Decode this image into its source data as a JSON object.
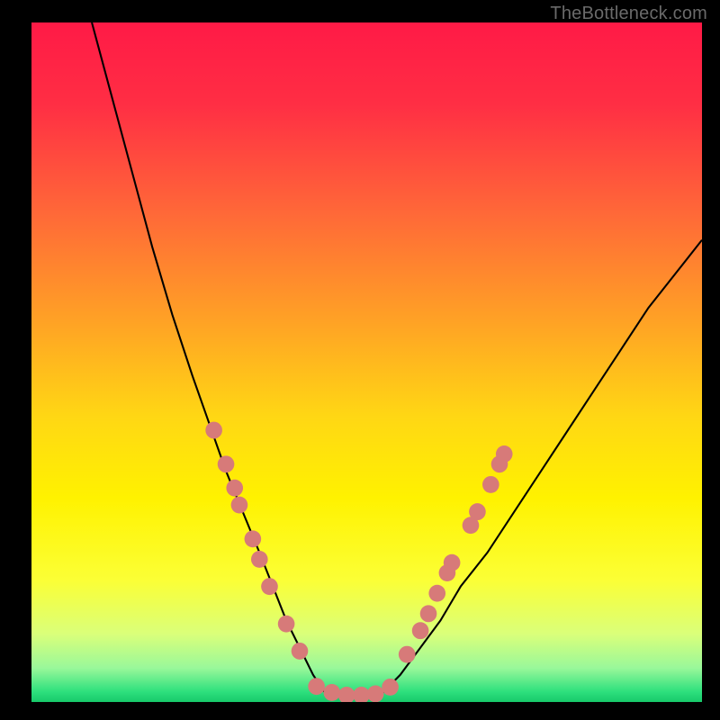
{
  "watermark": "TheBottleneck.com",
  "chart_data": {
    "type": "line",
    "title": "",
    "xlabel": "",
    "ylabel": "",
    "xlim": [
      0,
      100
    ],
    "ylim": [
      0,
      100
    ],
    "gradient_stops": [
      {
        "offset": 0.0,
        "color": "#ff1a46"
      },
      {
        "offset": 0.12,
        "color": "#ff2e44"
      },
      {
        "offset": 0.28,
        "color": "#ff6838"
      },
      {
        "offset": 0.44,
        "color": "#ffa225"
      },
      {
        "offset": 0.58,
        "color": "#ffd714"
      },
      {
        "offset": 0.7,
        "color": "#fff200"
      },
      {
        "offset": 0.82,
        "color": "#fbff35"
      },
      {
        "offset": 0.9,
        "color": "#daff7a"
      },
      {
        "offset": 0.95,
        "color": "#99f89a"
      },
      {
        "offset": 0.985,
        "color": "#2de07d"
      },
      {
        "offset": 1.0,
        "color": "#17c96a"
      }
    ],
    "series": [
      {
        "name": "left-curve",
        "x": [
          9,
          12,
          15,
          18,
          21,
          24,
          26.5,
          29,
          31.5,
          34,
          36,
          38,
          40,
          42,
          44
        ],
        "y": [
          100,
          89,
          78,
          67,
          57,
          48,
          41,
          34,
          28,
          22,
          17,
          12,
          8,
          4,
          1
        ]
      },
      {
        "name": "right-curve",
        "x": [
          52,
          55,
          58,
          61,
          64,
          68,
          72,
          76,
          80,
          84,
          88,
          92,
          96,
          100
        ],
        "y": [
          1,
          4,
          8,
          12,
          17,
          22,
          28,
          34,
          40,
          46,
          52,
          58,
          63,
          68
        ]
      }
    ],
    "marker_series": [
      {
        "name": "left-markers",
        "color": "#d77a79",
        "points": [
          {
            "x": 27.2,
            "y": 40.0
          },
          {
            "x": 29.0,
            "y": 35.0
          },
          {
            "x": 30.3,
            "y": 31.5
          },
          {
            "x": 31.0,
            "y": 29.0
          },
          {
            "x": 33.0,
            "y": 24.0
          },
          {
            "x": 34.0,
            "y": 21.0
          },
          {
            "x": 35.5,
            "y": 17.0
          },
          {
            "x": 38.0,
            "y": 11.5
          },
          {
            "x": 40.0,
            "y": 7.5
          }
        ]
      },
      {
        "name": "right-markers",
        "color": "#d77a79",
        "points": [
          {
            "x": 56.0,
            "y": 7.0
          },
          {
            "x": 58.0,
            "y": 10.5
          },
          {
            "x": 59.2,
            "y": 13.0
          },
          {
            "x": 60.5,
            "y": 16.0
          },
          {
            "x": 62.0,
            "y": 19.0
          },
          {
            "x": 62.7,
            "y": 20.5
          },
          {
            "x": 65.5,
            "y": 26.0
          },
          {
            "x": 66.5,
            "y": 28.0
          },
          {
            "x": 68.5,
            "y": 32.0
          },
          {
            "x": 69.8,
            "y": 35.0
          },
          {
            "x": 70.5,
            "y": 36.5
          }
        ]
      },
      {
        "name": "floor-markers",
        "color": "#d77a79",
        "points": [
          {
            "x": 42.5,
            "y": 2.3
          },
          {
            "x": 44.8,
            "y": 1.4
          },
          {
            "x": 47.0,
            "y": 1.0
          },
          {
            "x": 49.2,
            "y": 1.0
          },
          {
            "x": 51.3,
            "y": 1.2
          },
          {
            "x": 53.5,
            "y": 2.2
          }
        ]
      }
    ]
  }
}
